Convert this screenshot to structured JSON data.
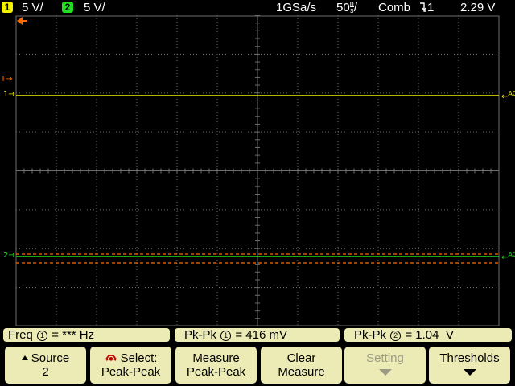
{
  "status": {
    "ch1_num": "1",
    "ch1_scale": "5 V/",
    "ch2_num": "2",
    "ch2_scale": "5 V/",
    "sample_rate": "1GSa/s",
    "timebase_value": "50",
    "timebase_unit_top": "n",
    "timebase_unit_bottom": "s",
    "timebase_suffix": "/",
    "acq_mode": "Comb",
    "trigger_icon": "falling-edge-icon",
    "trigger_source": "1",
    "trigger_level": "2.29 V"
  },
  "markers": {
    "trigger_pos": "T",
    "ch1_label": "1",
    "ch2_label": "2",
    "ch1_coupling": "AC",
    "ch2_coupling": "AC"
  },
  "measurements": [
    {
      "label": "Freq",
      "channel": "1",
      "eq": "=",
      "value": "*** Hz"
    },
    {
      "label": "Pk-Pk",
      "channel": "1",
      "eq": "=",
      "value": "416 mV"
    },
    {
      "label": "Pk-Pk",
      "channel": "2",
      "eq": "=",
      "value": "1.04  V"
    }
  ],
  "softkeys": [
    {
      "line1": "Source",
      "line2": "2"
    },
    {
      "line1": "Select:",
      "line2": "Peak-Peak"
    },
    {
      "line1": "Measure",
      "line2": "Peak-Peak"
    },
    {
      "line1": "Clear",
      "line2": "Measure"
    },
    {
      "line1": "Setting",
      "line2": ""
    },
    {
      "line1": "Thresholds",
      "line2": ""
    }
  ],
  "colors": {
    "ch1": "#f2f200",
    "ch2": "#1fe01f",
    "cursor": "#ff6a00",
    "panel": "#ecebb5",
    "grid": "#6e6e6e"
  }
}
